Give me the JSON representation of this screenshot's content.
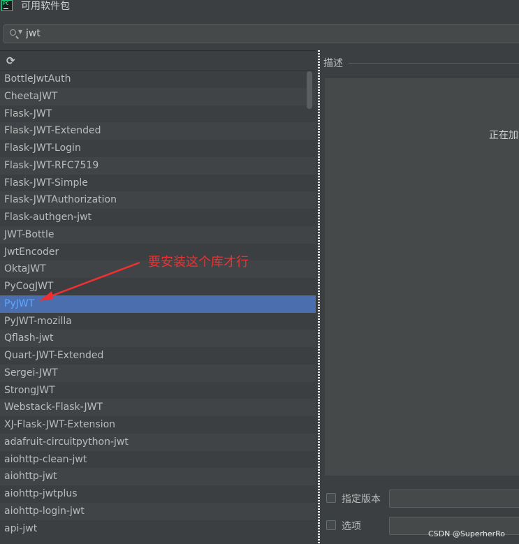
{
  "window": {
    "title": "可用软件包",
    "icon": "pycharm-logo",
    "icon_text": "PC"
  },
  "search": {
    "value": "jwt",
    "icon": "search-icon"
  },
  "toolbar": {
    "refresh_icon": "refresh-icon",
    "refresh_glyph": "⟳"
  },
  "packages": [
    "BottleJwtAuth",
    "CheetaJWT",
    "Flask-JWT",
    "Flask-JWT-Extended",
    "Flask-JWT-Login",
    "Flask-JWT-RFC7519",
    "Flask-JWT-Simple",
    "Flask-JWTAuthorization",
    "Flask-authgen-jwt",
    "JWT-Bottle",
    "JwtEncoder",
    "OktaJWT",
    "PyCogJWT",
    "PyJWT",
    "PyJWT-mozilla",
    "Qflash-jwt",
    "Quart-JWT-Extended",
    "Sergei-JWT",
    "StrongJWT",
    "Webstack-Flask-JWT",
    "XJ-Flask-JWT-Extension",
    "adafruit-circuitpython-jwt",
    "aiohttp-clean-jwt",
    "aiohttp-jwt",
    "aiohttp-jwtplus",
    "aiohttp-login-jwt",
    "api-jwt"
  ],
  "selected_package": "PyJWT",
  "details": {
    "description_label": "描述",
    "loading_text": "正在加载"
  },
  "options": {
    "specify_version_label": "指定版本",
    "options_label": "选项"
  },
  "annotation": {
    "text": "要安装这个库才行",
    "color": "#f03030"
  },
  "watermark": "CSDN @SuperherRo",
  "colors": {
    "selection": "#4b6eaf",
    "background": "#3c3f41",
    "selected_text": "#5ea7ff"
  }
}
